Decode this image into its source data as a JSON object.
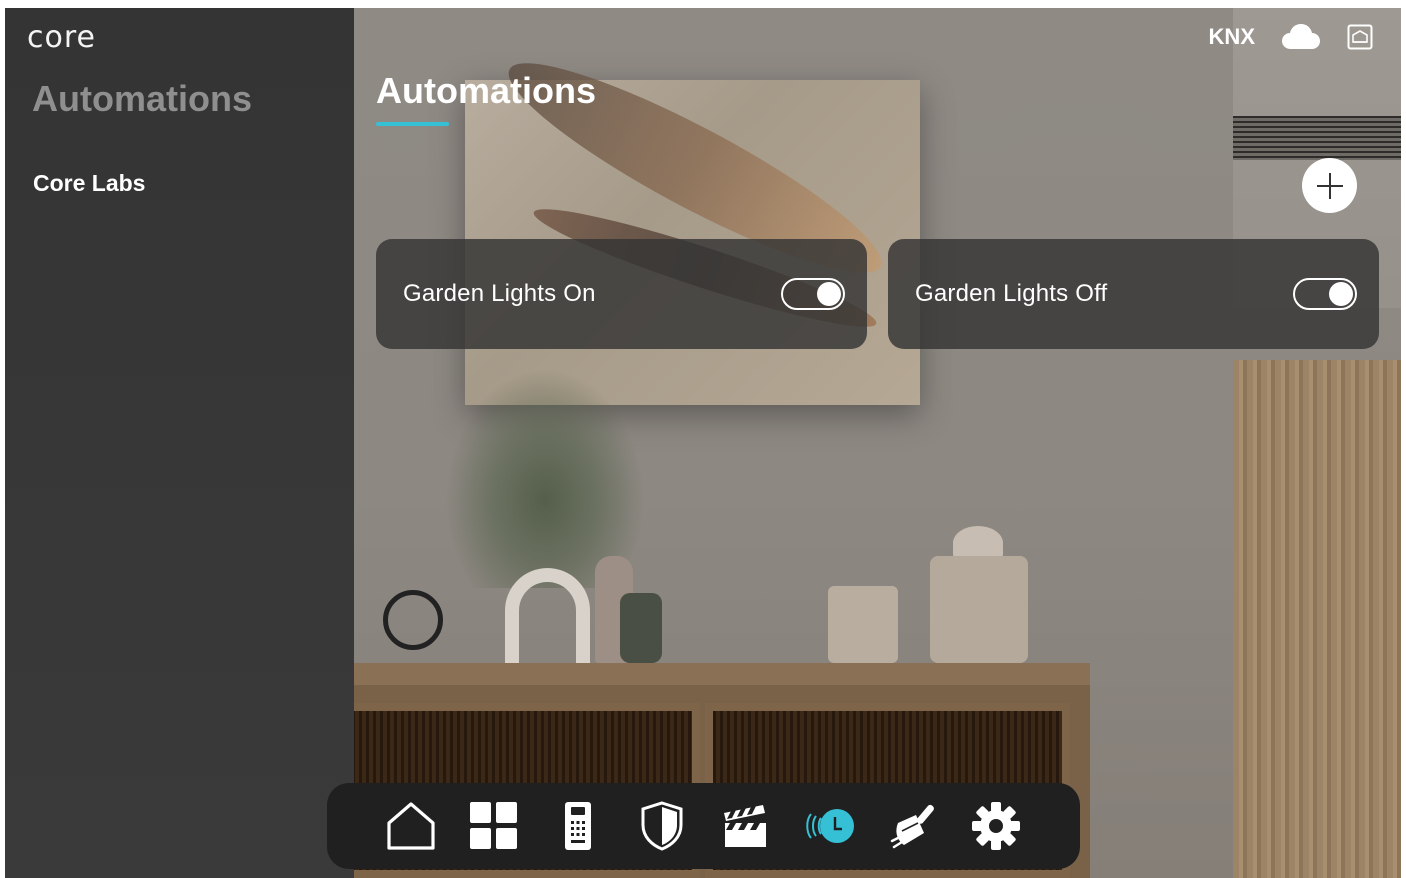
{
  "brand": {
    "logo_text": "core"
  },
  "sidebar": {
    "title": "Automations",
    "items": [
      {
        "label": "Core Labs"
      }
    ]
  },
  "header": {
    "title": "Automations",
    "status": {
      "protocol": "KNX"
    }
  },
  "automations": [
    {
      "name": "Garden Lights On",
      "enabled": true
    },
    {
      "name": "Garden Lights Off",
      "enabled": true
    }
  ],
  "icons": {
    "status": [
      "cloud-icon",
      "gateway-icon"
    ],
    "add": "plus-icon",
    "dock": [
      "home-icon",
      "rooms-grid-icon",
      "remote-icon",
      "security-shield-icon",
      "scenes-clapper-icon",
      "automation-clock-icon",
      "cleaning-icon",
      "settings-gear-icon"
    ]
  },
  "colors": {
    "accent": "#35c0d6",
    "sidebar_bg": "#343434",
    "card_bg": "#343434",
    "dock_bg": "#202020",
    "active_dock": "#35c0d6"
  }
}
